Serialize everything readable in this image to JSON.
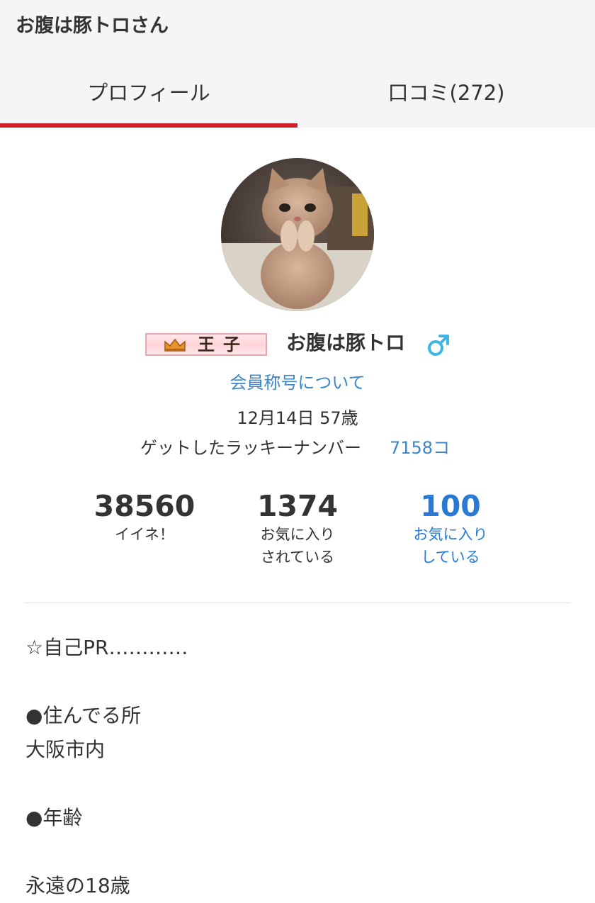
{
  "header": {
    "title": "お腹は豚トロさん"
  },
  "tabs": [
    {
      "label": "プロフィール",
      "active": true
    },
    {
      "label": "口コミ(272)",
      "active": false
    }
  ],
  "colors": {
    "accent": "#d0202a",
    "link": "#3c87c9",
    "stat_link": "#2a7ad3",
    "gender_male": "#3fb6e0"
  },
  "profile": {
    "avatar_icon": "cat-photo",
    "rank_badge": "王子",
    "rank_icon": "crown-icon",
    "username": "お腹は豚トロ",
    "gender_icon": "male-icon",
    "title_link": "会員称号について",
    "birthday": "12月14日 57歳",
    "lucky_label": "ゲットしたラッキーナンバー",
    "lucky_value": "7158コ"
  },
  "stats": [
    {
      "value": "38560",
      "label": "イイネ！"
    },
    {
      "value": "1374",
      "label": "お気に入り\nされている"
    },
    {
      "value": "100",
      "label": "お気に入り\nしている"
    }
  ],
  "bio": {
    "lines": [
      "☆自己PR…………",
      "",
      "●住んでる所",
      "大阪市内",
      "",
      "●年齢",
      "",
      "永遠の18歳"
    ]
  }
}
